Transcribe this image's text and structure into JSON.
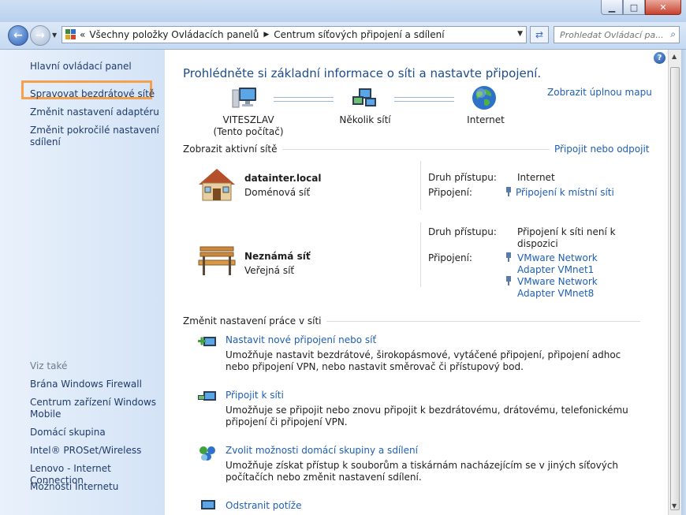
{
  "window": {
    "min": "▁",
    "max": "□",
    "close": "✕"
  },
  "address": {
    "segments": [
      "Všechny položky Ovládacích panelů",
      "Centrum síťových připojení a sdílení"
    ],
    "prefix": "«"
  },
  "search": {
    "placeholder": "Prohledat Ovládací pa..."
  },
  "sidebar": {
    "items": [
      "Hlavní ovládací panel",
      "Spravovat bezdrátové sítě",
      "Změnit nastavení adaptéru",
      "Změnit pokročilé nastavení sdílení"
    ],
    "see_also_header": "Viz také",
    "see_also": [
      "Brána Windows Firewall",
      "Centrum zařízení Windows Mobile",
      "Domácí skupina",
      "Intel® PROSet/Wireless",
      "Lenovo - Internet Connection",
      "Možnosti Internetu"
    ]
  },
  "main": {
    "title": "Prohlédněte si základní informace o síti a nastavte připojení.",
    "full_map_link": "Zobrazit úplnou mapu",
    "map": {
      "computer_name": "VITESZLAV",
      "computer_sub": "(Tento počítač)",
      "networks": "Několik sítí",
      "internet": "Internet"
    },
    "active_header": "Zobrazit aktivní sítě",
    "connect_link": "Připojit nebo odpojit",
    "active_networks": [
      {
        "name": "datainter.local",
        "type": "Doménová síť",
        "access_label": "Druh přístupu:",
        "access_value": "Internet",
        "conn_label": "Připojení:",
        "conn_links": [
          "Připojení k místní síti"
        ]
      },
      {
        "name": "Neznámá síť",
        "type": "Veřejná síť",
        "access_label": "Druh přístupu:",
        "access_value": "Připojení k síti není k dispozici",
        "conn_label": "Připojení:",
        "conn_links": [
          "VMware Network Adapter VMnet1",
          "VMware Network Adapter VMnet8"
        ]
      }
    ],
    "settings_header": "Změnit nastavení práce v síti",
    "tasks": [
      {
        "title": "Nastavit nové připojení nebo síť",
        "desc": "Umožňuje nastavit bezdrátové, širokopásmové, vytáčené připojení, připojení adhoc nebo připojení VPN, nebo nastavit směrovač či přístupový bod."
      },
      {
        "title": "Připojit k síti",
        "desc": "Umožňuje se připojit nebo znovu připojit k bezdrátovému, drátovému, telefonickému připojení či připojení VPN."
      },
      {
        "title": "Zvolit možnosti domácí skupiny a sdílení",
        "desc": "Umožňuje získat přístup k souborům a tiskárnám nacházejícím se v jiných síťových počítačích nebo změnit nastavení sdílení."
      },
      {
        "title": "Odstranit potíže",
        "desc": ""
      }
    ]
  },
  "colors": {
    "link": "#1e5fb4",
    "title": "#1d4d8c",
    "highlight": "#f5a04c"
  }
}
